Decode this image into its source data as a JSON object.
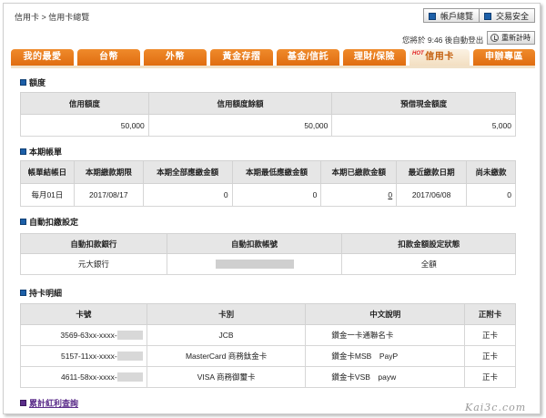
{
  "breadcrumb": "信用卡 > 信用卡總覽",
  "top_buttons": {
    "account": "帳戶總覽",
    "security": "交易安全"
  },
  "timer": {
    "text": "您將於 9:46 後自動登出",
    "button": "重新計時"
  },
  "tabs": [
    {
      "label": "我的最愛",
      "active": false
    },
    {
      "label": "台幣",
      "active": false
    },
    {
      "label": "外幣",
      "active": false
    },
    {
      "label": "黃金存摺",
      "active": false
    },
    {
      "label": "基金/信託",
      "active": false
    },
    {
      "label": "理財/保險",
      "active": false
    },
    {
      "label": "信用卡",
      "active": true,
      "badge": "HOT"
    },
    {
      "label": "申辦專區",
      "active": false
    }
  ],
  "credit_limit": {
    "title": "額度",
    "headers": [
      "信用額度",
      "信用額度餘額",
      "預借現金額度"
    ],
    "values": [
      "50,000",
      "50,000",
      "5,000"
    ]
  },
  "statement": {
    "title": "本期帳單",
    "headers": [
      "帳單結帳日",
      "本期繳款期限",
      "本期全部應繳金額",
      "本期最低應繳金額",
      "本期已繳款金額",
      "最近繳款日期",
      "尚未繳款"
    ],
    "values": [
      "每月01日",
      "2017/08/17",
      "0",
      "0",
      "0",
      "2017/06/08",
      "0"
    ]
  },
  "autopay": {
    "title": "自動扣繳設定",
    "headers": [
      "自動扣款銀行",
      "自動扣款帳號",
      "扣款金額設定狀態"
    ],
    "values": [
      "元大銀行",
      "",
      "全額"
    ]
  },
  "cards": {
    "title": "持卡明細",
    "headers": [
      "卡號",
      "卡別",
      "中文說明",
      "正附卡"
    ],
    "rows": [
      {
        "number": "3569-63xx-xxxx-",
        "type": "JCB",
        "desc": "鑽金一卡通聯名卡",
        "primary": "正卡"
      },
      {
        "number": "5157-11xx-xxxx-",
        "type": "MasterCard 商務鈦金卡",
        "desc": "鑽金卡MSB　PayP",
        "primary": "正卡"
      },
      {
        "number": "4611-58xx-xxxx-",
        "type": "VISA 商務御璽卡",
        "desc": "鑽金卡VSB　payw",
        "primary": "正卡"
      }
    ]
  },
  "rewards_link": "累計紅利查詢",
  "watermark": "Kai3c.com",
  "colors": {
    "tab_orange": "#e67a1c",
    "active_tab_text": "#c35d0a",
    "header_gray": "#e6e6e6",
    "bullet_blue": "#1c5fa8"
  }
}
